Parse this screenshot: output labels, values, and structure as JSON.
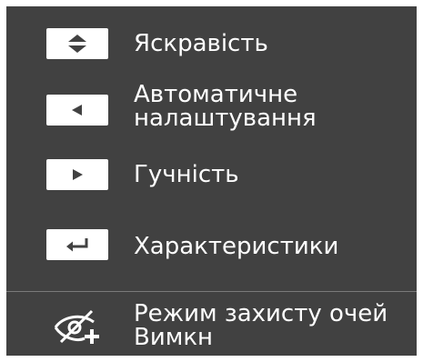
{
  "menu": {
    "brightness_label": "Яскравість",
    "auto_adjust_label_line1": "Автоматичне",
    "auto_adjust_label_line2": "налаштування",
    "volume_label": "Гучність",
    "features_label": "Характеристики"
  },
  "eye_saver": {
    "label_line1": "Режим захисту очей",
    "status": "Вимкн"
  },
  "icons": {
    "brightness": "up-down-icon",
    "auto_adjust": "left-arrow-icon",
    "volume": "right-arrow-icon",
    "features": "enter-return-icon",
    "eye_saver": "eye-saver-off-icon"
  },
  "colors": {
    "panel_background": "#414141",
    "key_background": "#ffffff",
    "text": "#ffffff",
    "divider": "#7a7a7a"
  }
}
